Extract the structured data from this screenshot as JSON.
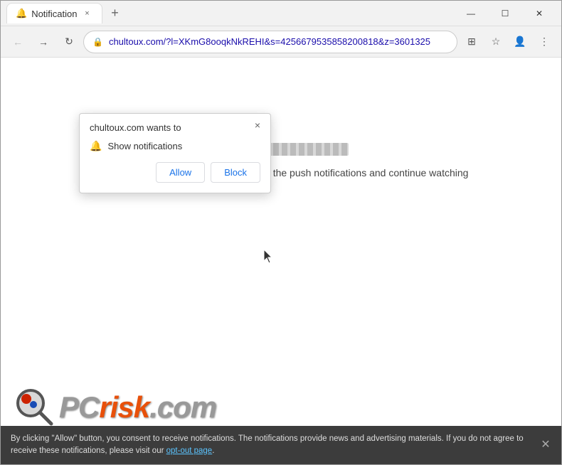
{
  "window": {
    "title": "Notification",
    "favicon": "notification-icon"
  },
  "titlebar": {
    "tab_label": "Notification",
    "close_tab_label": "×",
    "new_tab_label": "+",
    "minimize_label": "—",
    "maximize_label": "☐",
    "close_label": "✕"
  },
  "toolbar": {
    "back_label": "←",
    "forward_label": "→",
    "reload_label": "↻",
    "url": "chultoux.com/?l=XKmG8ooqkNkREHI&s=4256679535858200818&z=3601325",
    "extensions_label": "⊞",
    "favorites_label": "☆",
    "profile_label": "👤",
    "menu_label": "⋮"
  },
  "notification_popup": {
    "title": "chultoux.com wants to",
    "close_label": "×",
    "item_icon": "🔔",
    "item_text": "Show notifications",
    "allow_label": "Allow",
    "block_label": "Block"
  },
  "page": {
    "instruction": "Click the «Allow» button to subscribe to the push notifications and continue watching"
  },
  "logo": {
    "pc_text": "PC",
    "risk_text": "risk",
    "dot_com_text": ".com"
  },
  "bottom_banner": {
    "text": "By clicking \"Allow\" button, you consent to receive notifications. The notifications provide news and advertising materials. If you do not agree to receive these notifications, please visit our ",
    "link_text": "opt-out page",
    "text_end": ".",
    "close_label": "✕"
  }
}
